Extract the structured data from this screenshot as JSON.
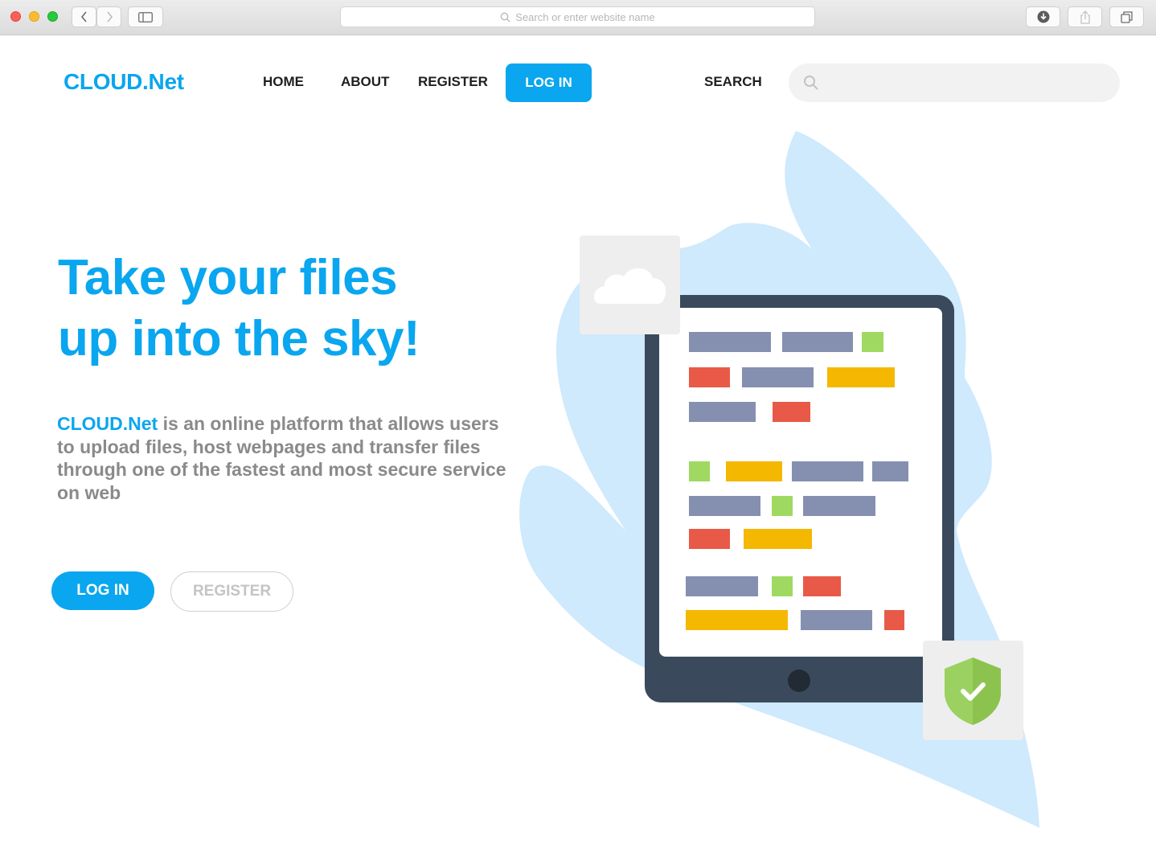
{
  "browser": {
    "address_placeholder": "Search or enter website name",
    "icons": [
      "back-icon",
      "forward-icon",
      "sidebar-icon",
      "search-icon",
      "download-icon",
      "share-icon",
      "tabs-icon"
    ]
  },
  "nav": {
    "logo": "CLOUD.Net",
    "links": [
      "HOME",
      "ABOUT",
      "REGISTER"
    ],
    "login_label": "LOG IN",
    "search_label": "SEARCH",
    "search_placeholder": ""
  },
  "hero": {
    "title_line1": "Take your files",
    "title_line2": "up into the sky!",
    "desc_brand": "CLOUD.Net",
    "desc_rest": " is an online platform that allows users to upload files, host webpages and transfer files through one of the fastest and most secure service on web",
    "login_button": "LOG IN",
    "register_button": "REGISTER"
  },
  "colors": {
    "accent": "#0aa6ef",
    "text_dark": "#1f1f1f",
    "text_grey": "#8a8a8a",
    "blob": "#cfe9fd",
    "tablet": "#3a4a5c",
    "bar_grey": "#8590b1",
    "bar_red": "#e85a47",
    "bar_yellow": "#f4b800",
    "bar_green": "#9fd962",
    "shield": "#9bd160"
  }
}
